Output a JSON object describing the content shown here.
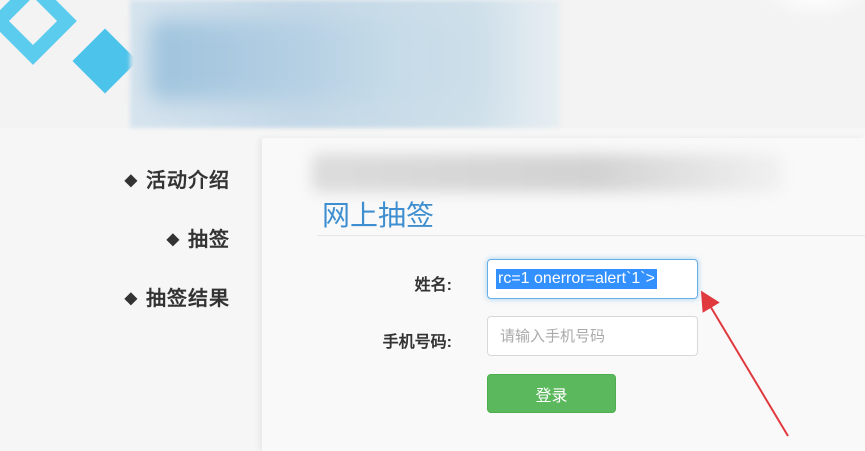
{
  "sidebar": {
    "bullet": "◆",
    "items": [
      {
        "label": "活动介绍"
      },
      {
        "label": "抽签"
      },
      {
        "label": "抽签结果"
      }
    ]
  },
  "main": {
    "title": "网上抽签",
    "form": {
      "name_label": "姓名:",
      "name_value": "rc=1 onerror=alert`1`>",
      "phone_label": "手机号码:",
      "phone_placeholder": "请输入手机号码",
      "submit_label": "登录"
    }
  },
  "colors": {
    "title": "#3f8fd0",
    "button": "#5cb85c",
    "selection": "#3390ff",
    "arrow": "#e0393e",
    "logo": "#56c7ea"
  }
}
